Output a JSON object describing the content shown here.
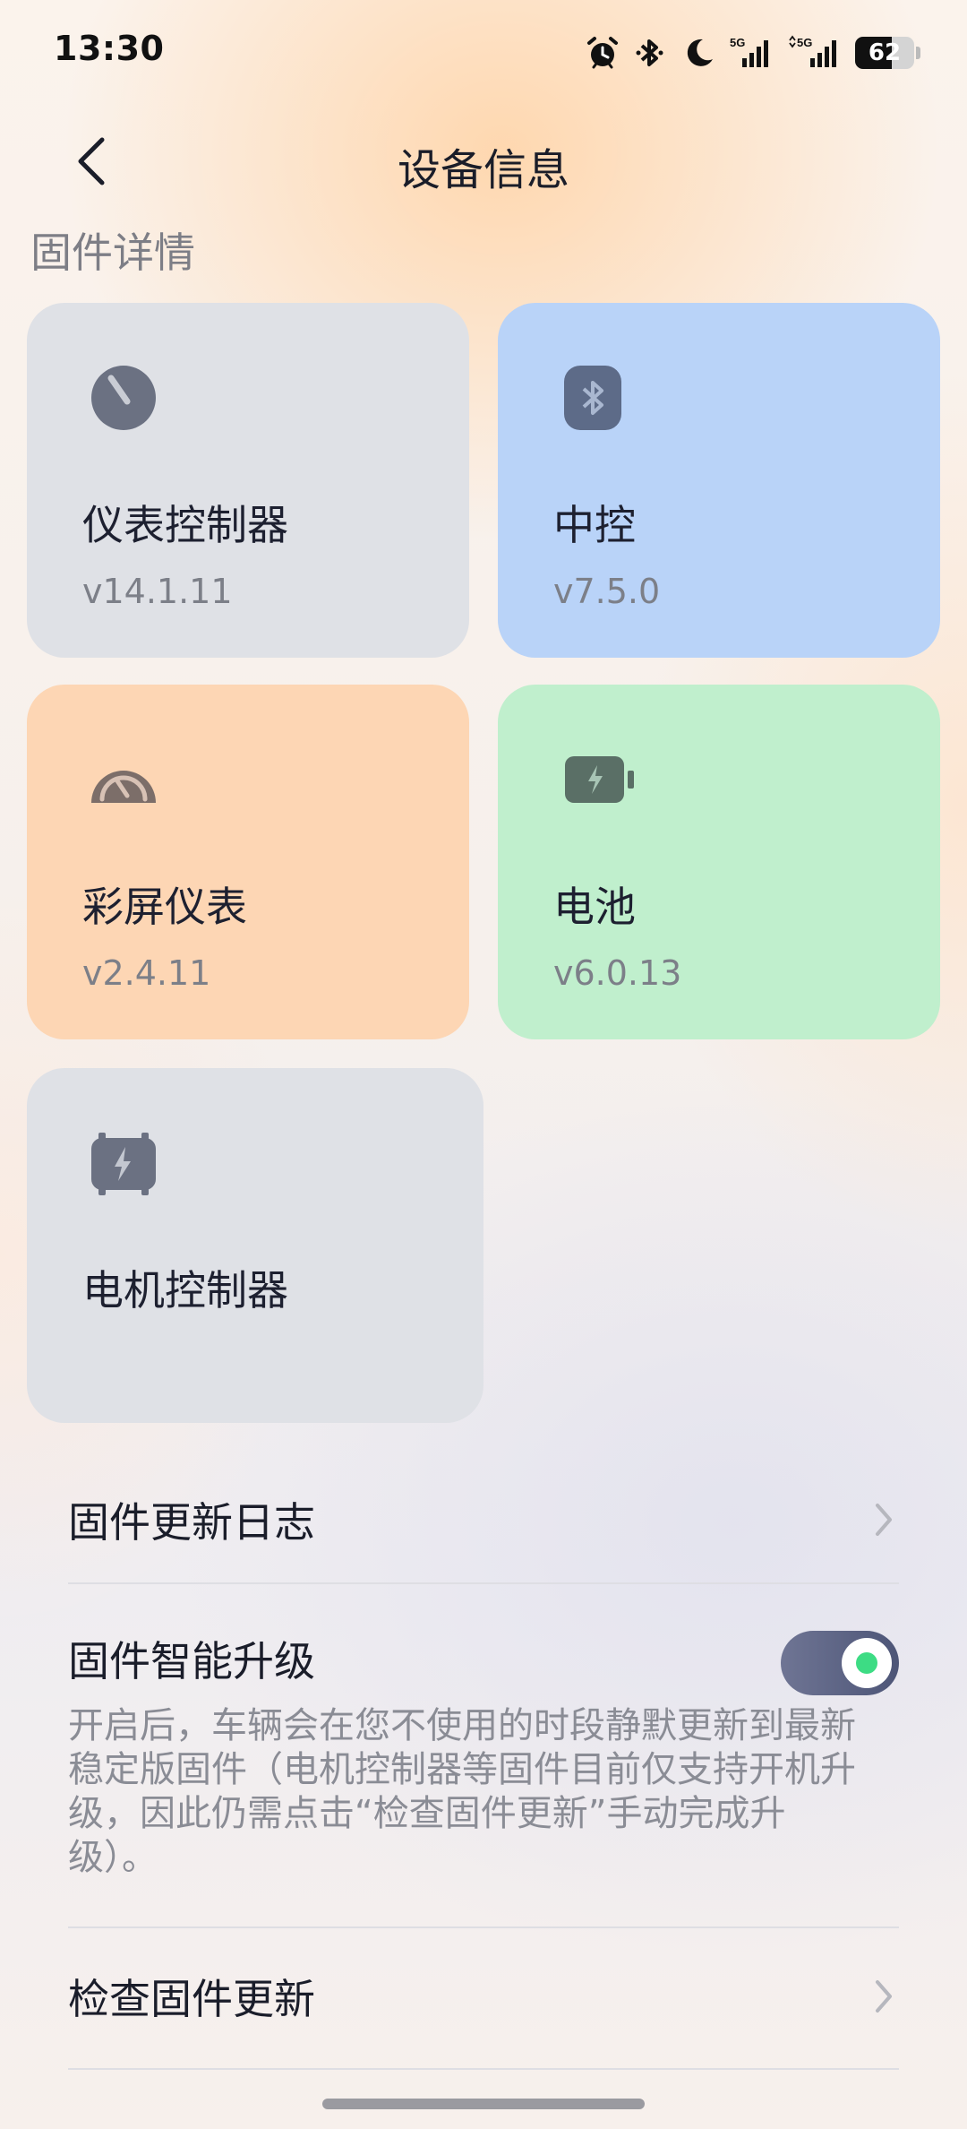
{
  "status_bar": {
    "time": "13:30",
    "network_1": "5G",
    "network_2": "5G",
    "battery_level": "62",
    "battery_fraction": 0.62,
    "icons": [
      "alarm-icon",
      "bluetooth-icon",
      "moon-icon",
      "signal-5g-icon",
      "signal-5g-icon",
      "battery-icon"
    ]
  },
  "header": {
    "title": "设备信息",
    "back_icon": "chevron-left-icon"
  },
  "firmware": {
    "section_title": "固件详情",
    "cards": [
      {
        "name": "仪表控制器",
        "version": "v14.1.11",
        "icon": "gauge-needle-icon",
        "color": "#dfe1e6"
      },
      {
        "name": "中控",
        "version": "v7.5.0",
        "icon": "bluetooth-icon",
        "color": "#b9d3f8"
      },
      {
        "name": "彩屏仪表",
        "version": "v2.4.11",
        "icon": "speedometer-icon",
        "color": "#fdd6b4"
      },
      {
        "name": "电池",
        "version": "v6.0.13",
        "icon": "battery-bolt-icon",
        "color": "#c0efcd"
      },
      {
        "name": "电机控制器",
        "version": "",
        "icon": "motor-bolt-icon",
        "color": "#dfe1e6"
      }
    ]
  },
  "settings": {
    "update_log_label": "固件更新日志",
    "auto_upgrade_label": "固件智能升级",
    "auto_upgrade_enabled": true,
    "auto_upgrade_desc": "开启后，车辆会在您不使用的时段静默更新到最新稳定版固件（电机控制器等固件目前仅支持开机升级，因此仍需点击“检查固件更新”手动完成升级）。",
    "check_update_label": "检查固件更新"
  },
  "colors": {
    "toggle_on": "#4d5577",
    "toggle_dot": "#3ddc84"
  }
}
